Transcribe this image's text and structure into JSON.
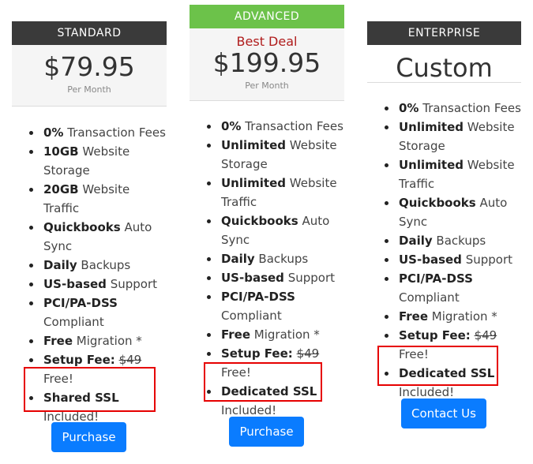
{
  "plans": [
    {
      "name": "STANDARD",
      "deal": "",
      "price": "$79.95",
      "period": "Per Month",
      "features": [
        {
          "bold": "0%",
          "rest": " Transaction Fees"
        },
        {
          "bold": "10GB",
          "rest": " Website Storage"
        },
        {
          "bold": "20GB",
          "rest": " Website Traffic"
        },
        {
          "bold": "Quickbooks",
          "rest": " Auto Sync"
        },
        {
          "bold": "Daily",
          "rest": " Backups"
        },
        {
          "bold": "US-based",
          "rest": " Support"
        },
        {
          "bold": "PCI/PA-DSS",
          "rest": " Compliant"
        },
        {
          "bold": "Free",
          "rest": " Migration *"
        },
        {
          "bold": "Setup Fee:",
          "strike": "$49",
          "rest": " Free!"
        },
        {
          "bold": "Shared SSL",
          "rest": " Included!"
        }
      ],
      "button": "Purchase"
    },
    {
      "name": "ADVANCED",
      "deal": "Best Deal",
      "price": "$199.95",
      "period": "Per Month",
      "features": [
        {
          "bold": "0%",
          "rest": " Transaction Fees"
        },
        {
          "bold": "Unlimited",
          "rest": " Website Storage"
        },
        {
          "bold": "Unlimited",
          "rest": " Website Traffic"
        },
        {
          "bold": "Quickbooks",
          "rest": " Auto Sync"
        },
        {
          "bold": "Daily",
          "rest": " Backups"
        },
        {
          "bold": "US-based",
          "rest": " Support"
        },
        {
          "bold": "PCI/PA-DSS",
          "rest": " Compliant"
        },
        {
          "bold": "Free",
          "rest": " Migration *"
        },
        {
          "bold": "Setup Fee:",
          "strike": "$49",
          "rest": " Free!"
        },
        {
          "bold": "Dedicated SSL",
          "rest": " Included!"
        }
      ],
      "button": "Purchase"
    },
    {
      "name": "ENTERPRISE",
      "deal": "",
      "price": "Custom",
      "period": "",
      "features": [
        {
          "bold": "0%",
          "rest": " Transaction Fees"
        },
        {
          "bold": "Unlimited",
          "rest": " Website Storage"
        },
        {
          "bold": "Unlimited",
          "rest": " Website Traffic"
        },
        {
          "bold": "Quickbooks",
          "rest": " Auto Sync"
        },
        {
          "bold": "Daily",
          "rest": " Backups"
        },
        {
          "bold": "US-based",
          "rest": " Support"
        },
        {
          "bold": "PCI/PA-DSS",
          "rest": " Compliant"
        },
        {
          "bold": "Free",
          "rest": " Migration *"
        },
        {
          "bold": "Setup Fee:",
          "strike": "$49",
          "rest": " Free!"
        },
        {
          "bold": "Dedicated SSL",
          "rest": " Included!"
        }
      ],
      "button": "Contact Us"
    }
  ],
  "colors": {
    "header_dark": "#3a3a3a",
    "header_green": "#6cc24a",
    "deal_red": "#b01c1c",
    "button_blue": "#0a7cff",
    "highlight_red": "#e60000"
  }
}
